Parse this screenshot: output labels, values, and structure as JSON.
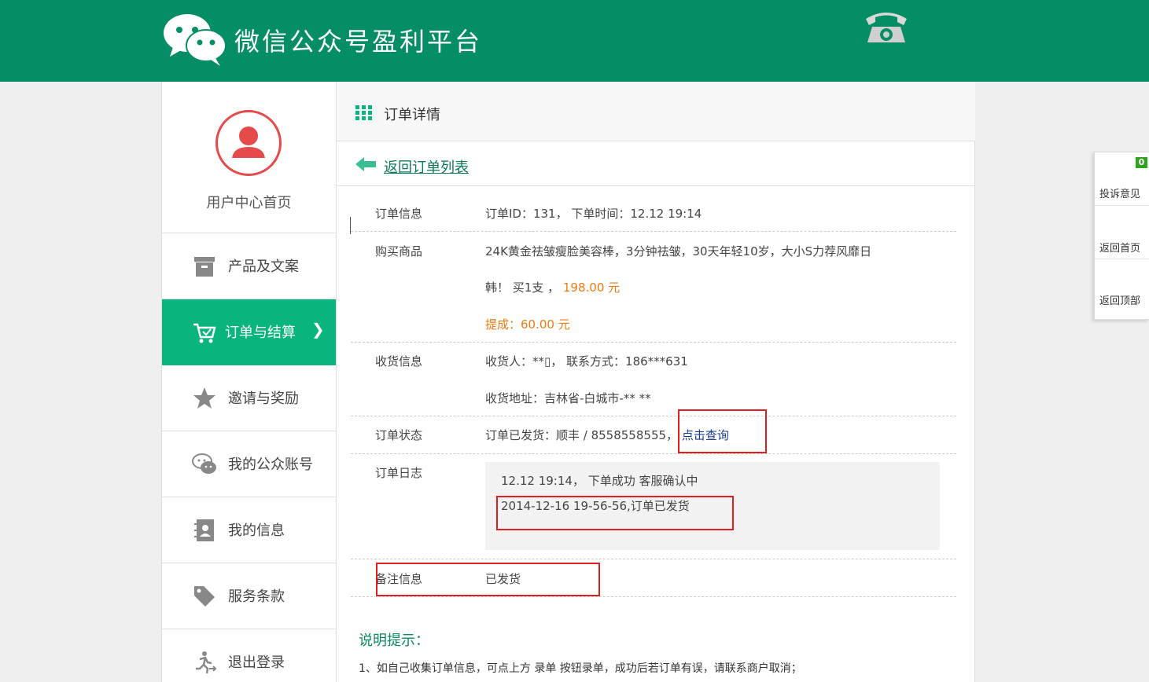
{
  "header": {
    "brand": "微信公众号盈利平台",
    "logo_icon": "wechat-logo-icon",
    "phone_icon": "telephone-icon",
    "bg_color": "#058d66"
  },
  "sidebar": {
    "home_label": "用户中心首页",
    "items": [
      {
        "label": "产品及文案",
        "icon": "archive-box-icon"
      },
      {
        "label": "订单与结算",
        "icon": "cart-icon",
        "active": true,
        "chevron": "❯"
      },
      {
        "label": "邀请与奖励",
        "icon": "star-icon"
      },
      {
        "label": "我的公众账号",
        "icon": "chat-bubbles-icon"
      },
      {
        "label": "我的信息",
        "icon": "contact-card-icon"
      },
      {
        "label": "服务条款",
        "icon": "tag-icon"
      },
      {
        "label": "退出登录",
        "icon": "running-exit-icon"
      }
    ],
    "active_color": "#0ab47f"
  },
  "panel": {
    "title": "订单详情",
    "back_link": "返回订单列表"
  },
  "order": {
    "info_label": "订单信息",
    "info_value": "订单ID：131， 下单时间：12.12 19:14",
    "goods_label": "购买商品",
    "goods_line1": "24K黄金祛皱瘦脸美容棒，3分钟祛皱，30天年轻10岁，大小S力荐风靡日",
    "goods_line2_prefix": "韩！   买1支 ，",
    "goods_price": "198.00 元",
    "commission": "提成：60.00 元",
    "ship_label": "收货信息",
    "ship_line1": "收货人：**▯， 联系方式：186***631",
    "ship_line2": "收货地址：吉林省-白城市-** **",
    "status_label": "订单状态",
    "status_value": "订单已发货：顺丰 / 8558558555，",
    "query_link": "点击查询",
    "log_label": "订单日志",
    "log_line1": "12.12 19:14， 下单成功 客服确认中",
    "log_line2": "2014-12-16 19-56-56,订单已发货",
    "remark_label": "备注信息",
    "remark_value": "已发货"
  },
  "notes": {
    "title": "说明提示：",
    "line1": "1、如自己收集订单信息，可点上方 录单 按钮录单，成功后若订单有误，请联系商户取消；"
  },
  "float_bar": {
    "badge": "0",
    "items": [
      "投诉意见",
      "返回首页",
      "返回顶部"
    ]
  }
}
